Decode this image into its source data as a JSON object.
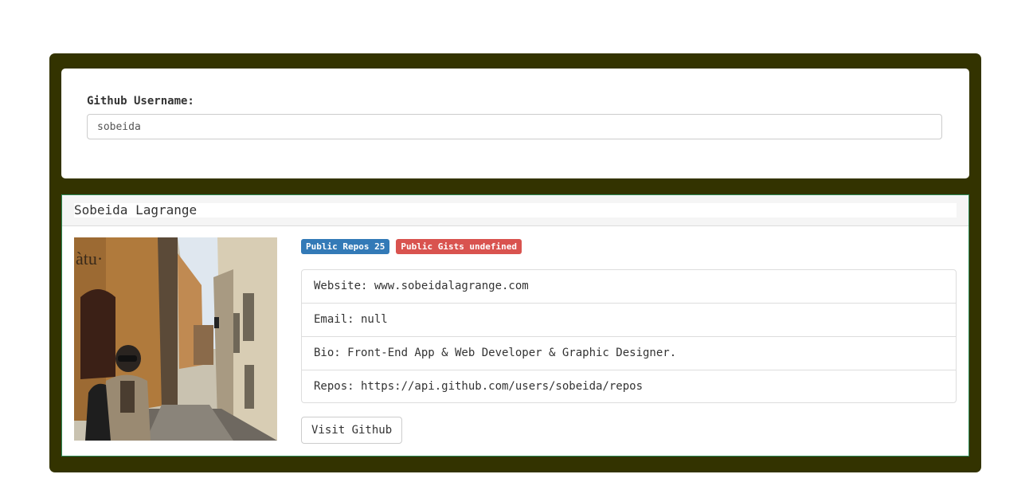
{
  "search": {
    "label": "Github Username:",
    "value": "sobeida"
  },
  "profile": {
    "name": "Sobeida Lagrange",
    "badges": {
      "repos": "Public Repos 25",
      "gists": "Public Gists undefined"
    },
    "details": {
      "website": "Website: www.sobeidalagrange.com",
      "email": "Email: null",
      "bio": "Bio: Front-End App & Web Developer & Graphic Designer.",
      "repos": "Repos: https://api.github.com/users/sobeida/repos"
    },
    "visit_label": "Visit Github"
  },
  "colors": {
    "frame": "#333300",
    "badge_primary": "#337ab7",
    "badge_danger": "#d9534f"
  }
}
